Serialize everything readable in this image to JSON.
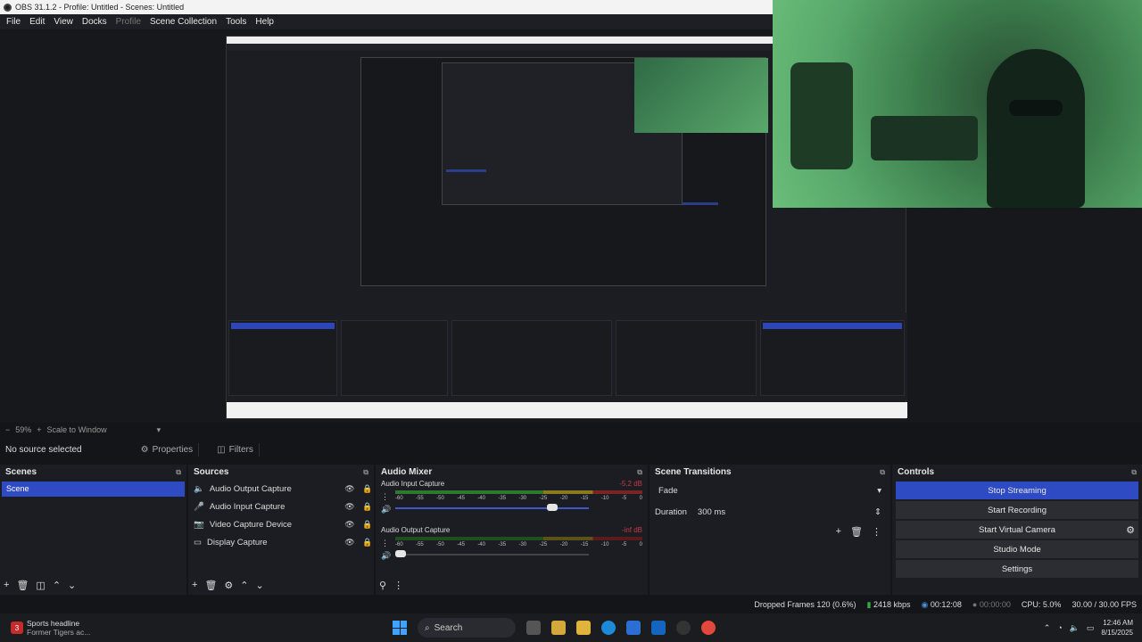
{
  "titlebar": {
    "title": "OBS 31.1.2 - Profile: Untitled - Scenes: Untitled"
  },
  "menu": [
    {
      "label": "File",
      "disabled": false
    },
    {
      "label": "Edit",
      "disabled": false
    },
    {
      "label": "View",
      "disabled": false
    },
    {
      "label": "Docks",
      "disabled": false
    },
    {
      "label": "Profile",
      "disabled": true
    },
    {
      "label": "Scene Collection",
      "disabled": false
    },
    {
      "label": "Tools",
      "disabled": false
    },
    {
      "label": "Help",
      "disabled": false
    }
  ],
  "preview_bar": {
    "zoom": "59%",
    "scale_mode": "Scale to Window"
  },
  "source_bar": {
    "no_source": "No source selected",
    "properties": "Properties",
    "filters": "Filters"
  },
  "scenes": {
    "title": "Scenes",
    "items": [
      "Scene"
    ]
  },
  "sources": {
    "title": "Sources",
    "items": [
      {
        "name": "Audio Output Capture",
        "icon": "speaker-icon"
      },
      {
        "name": "Audio Input Capture",
        "icon": "microphone-icon"
      },
      {
        "name": "Video Capture Device",
        "icon": "camera-icon"
      },
      {
        "name": "Display Capture",
        "icon": "monitor-icon"
      }
    ]
  },
  "mixer": {
    "title": "Audio Mixer",
    "scale": [
      "-60",
      "-55",
      "-50",
      "-45",
      "-40",
      "-35",
      "-30",
      "-25",
      "-20",
      "-15",
      "-10",
      "-5",
      "0"
    ],
    "channels": [
      {
        "name": "Audio Input Capture",
        "level": "-5.2 dB",
        "volume": 0.85
      },
      {
        "name": "Audio Output Capture",
        "level": "-inf dB",
        "volume": 0.0
      }
    ]
  },
  "transitions": {
    "title": "Scene Transitions",
    "selected": "Fade",
    "duration_label": "Duration",
    "duration_value": "300 ms"
  },
  "controls": {
    "title": "Controls",
    "buttons": [
      "Stop Streaming",
      "Start Recording",
      "Start Virtual Camera",
      "Studio Mode",
      "Settings"
    ]
  },
  "status": {
    "dropped": "Dropped Frames 120 (0.6%)",
    "kbps": "2418 kbps",
    "stream_time": "00:12:08",
    "rec_time": "00:00:00",
    "cpu": "CPU: 5.0%",
    "fps": "30.00 / 30.00 FPS"
  },
  "taskbar": {
    "news_title": "Sports headline",
    "news_sub": "Former Tigers ac...",
    "news_badge": "3",
    "search": "Search",
    "time": "12:46 AM",
    "date": "8/15/2025"
  },
  "colors": {
    "accent": "#2f4bc4",
    "bg": "#1c1d22",
    "live": "#34a845"
  }
}
